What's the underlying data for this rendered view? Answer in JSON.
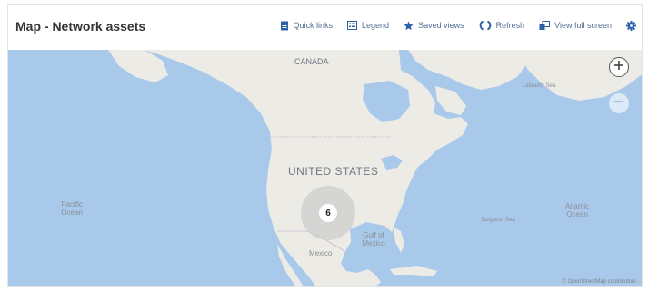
{
  "header": {
    "title": "Map - Network assets",
    "toolbar": [
      {
        "label": "Quick links",
        "icon": "document-icon"
      },
      {
        "label": "Legend",
        "icon": "legend-icon"
      },
      {
        "label": "Saved views",
        "icon": "star-icon"
      },
      {
        "label": "Refresh",
        "icon": "refresh-icon"
      },
      {
        "label": "View full screen",
        "icon": "fullscreen-icon"
      }
    ],
    "settings_icon": "gear-icon"
  },
  "map": {
    "labels": {
      "canada": "CANADA",
      "united_states": "UNITED STATES",
      "mexico": "Mexico",
      "gulf": "Gulf of Mexico",
      "pacific": "Pacific Ocean",
      "atlantic": "Atlantic Ocean",
      "labrador": "Labrador Sea",
      "sargasso": "Sargasso Sea"
    },
    "cluster_count": "6",
    "zoom_in_icon": "plus-icon",
    "zoom_out_icon": "minus-icon",
    "attribution": "© OpenStreetMap contributors",
    "colors": {
      "water": "#a9c9ea",
      "land": "#ecebe5",
      "accent": "#2b5fa6"
    }
  }
}
